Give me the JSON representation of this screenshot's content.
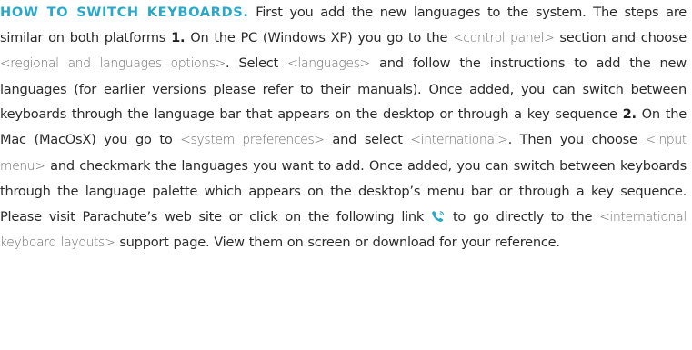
{
  "article": {
    "heading": "HOW TO SWITCH KEYBOARDS.",
    "t1": " First you add the new languages to the system.  The steps are similar on both platforms  ",
    "step1": "1.",
    "t2": " On the PC (Windows XP) you go to the ",
    "term_control_panel": "<control panel>",
    "t3": " section and choose ",
    "term_regional": "<regional and languages options>",
    "t4": ".  Select ",
    "term_languages": "<languages>",
    "t5": " and follow the instructions to add the new languages (for earlier versions please refer to their manuals).  Once added, you can switch between keyboards through the language bar that appears on the desktop or through a key sequence  ",
    "step2": "2.",
    "t6": " On the Mac (MacOsX) you go to ",
    "term_system_prefs": "<system preferences>",
    "t7": " and select ",
    "term_international": "<international>",
    "t8": ".  Then you choose ",
    "term_input_menu": "<input menu>",
    "t9": " and checkmark the languages you want to add.  Once added, you can switch between keyboards through the language palette which appears on the desktop’s menu bar or through a key sequence.  Please visit Parachute’s web site or click on the following link ",
    "t10": " to go directly to the ",
    "term_intl_layouts": "<international keyboard layouts>",
    "t11": " support page.  View them on screen or download for your reference."
  },
  "icons": {
    "link_icon": "phone-icon",
    "link_icon_color": "#2aa7c9"
  },
  "colors": {
    "heading": "#2aa7c9",
    "body": "#2b2b2b",
    "term": "#6e6e6e"
  }
}
